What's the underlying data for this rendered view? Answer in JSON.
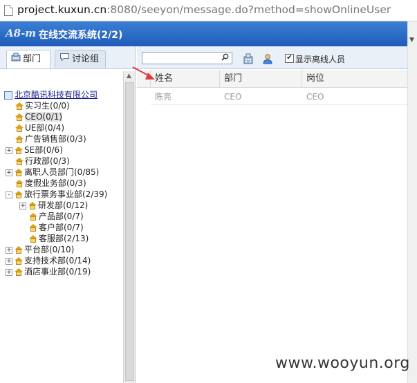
{
  "address_bar": {
    "url_host": "project.kuxun.cn",
    "url_rest": ":8080/seeyon/message.do?method=showOnlineUser"
  },
  "window": {
    "logo_text": "A8-m",
    "title": "在线交流系统(2/2)"
  },
  "left_panel": {
    "tabs": [
      {
        "label": "部门",
        "icon": "department-icon",
        "active": true
      },
      {
        "label": "讨论组",
        "icon": "chat-bubble-icon",
        "active": false
      }
    ],
    "tree": {
      "root": "北京酷讯科技有限公司",
      "nodes": [
        {
          "label": "实习生(0/0)",
          "level": 1,
          "expandable": false
        },
        {
          "label": "CEO(0/1)",
          "level": 1,
          "expandable": false,
          "selected": true
        },
        {
          "label": "UE部(0/4)",
          "level": 1,
          "expandable": false
        },
        {
          "label": "广告销售部(0/3)",
          "level": 1,
          "expandable": false
        },
        {
          "label": "SE部(0/6)",
          "level": 1,
          "expandable": true,
          "state": "+"
        },
        {
          "label": "行政部(0/3)",
          "level": 1,
          "expandable": false
        },
        {
          "label": "离职人员部门(0/85)",
          "level": 1,
          "expandable": true,
          "state": "+"
        },
        {
          "label": "度假业务部(0/3)",
          "level": 1,
          "expandable": false
        },
        {
          "label": "旅行票务事业部(2/39)",
          "level": 1,
          "expandable": true,
          "state": "-"
        },
        {
          "label": "研发部(0/12)",
          "level": 2,
          "expandable": true,
          "state": "+"
        },
        {
          "label": "产品部(0/7)",
          "level": 2,
          "expandable": false
        },
        {
          "label": "客户部(0/7)",
          "level": 2,
          "expandable": false
        },
        {
          "label": "客服部(2/13)",
          "level": 2,
          "expandable": false
        },
        {
          "label": "平台部(0/10)",
          "level": 1,
          "expandable": true,
          "state": "+"
        },
        {
          "label": "支持技术部(0/14)",
          "level": 1,
          "expandable": true,
          "state": "+"
        },
        {
          "label": "酒店事业部(0/19)",
          "level": 1,
          "expandable": true,
          "state": "+"
        }
      ]
    }
  },
  "right_panel": {
    "search": {
      "value": "",
      "placeholder": ""
    },
    "show_offline": {
      "label": "显示离线人员",
      "checked": true
    },
    "columns": [
      "姓名",
      "部门",
      "岗位"
    ],
    "rows": [
      [
        "陈亮",
        "CEO",
        "CEO"
      ]
    ]
  },
  "watermark": "www.wooyun.org",
  "colors": {
    "title_bar": "#2a6bc6",
    "panel_bg": "#eaf0f7",
    "annotation_arrow": "#e03a3a"
  }
}
